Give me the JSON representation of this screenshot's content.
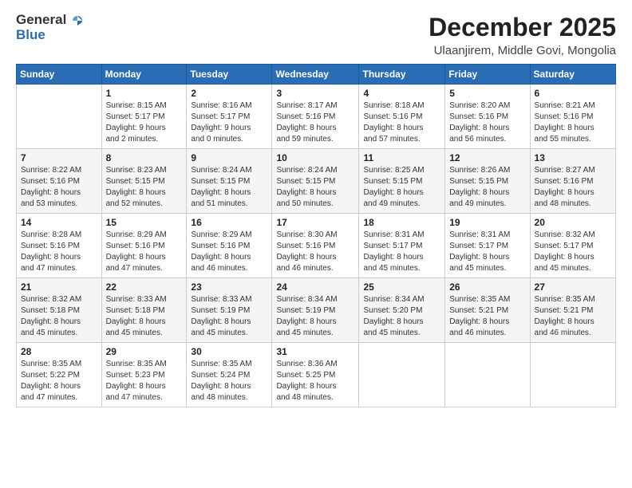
{
  "header": {
    "logo_general": "General",
    "logo_blue": "Blue",
    "main_title": "December 2025",
    "subtitle": "Ulaanjirem, Middle Govi, Mongolia"
  },
  "calendar": {
    "weekdays": [
      "Sunday",
      "Monday",
      "Tuesday",
      "Wednesday",
      "Thursday",
      "Friday",
      "Saturday"
    ],
    "weeks": [
      [
        {
          "day": "",
          "detail": ""
        },
        {
          "day": "1",
          "detail": "Sunrise: 8:15 AM\nSunset: 5:17 PM\nDaylight: 9 hours\nand 2 minutes."
        },
        {
          "day": "2",
          "detail": "Sunrise: 8:16 AM\nSunset: 5:17 PM\nDaylight: 9 hours\nand 0 minutes."
        },
        {
          "day": "3",
          "detail": "Sunrise: 8:17 AM\nSunset: 5:16 PM\nDaylight: 8 hours\nand 59 minutes."
        },
        {
          "day": "4",
          "detail": "Sunrise: 8:18 AM\nSunset: 5:16 PM\nDaylight: 8 hours\nand 57 minutes."
        },
        {
          "day": "5",
          "detail": "Sunrise: 8:20 AM\nSunset: 5:16 PM\nDaylight: 8 hours\nand 56 minutes."
        },
        {
          "day": "6",
          "detail": "Sunrise: 8:21 AM\nSunset: 5:16 PM\nDaylight: 8 hours\nand 55 minutes."
        }
      ],
      [
        {
          "day": "7",
          "detail": "Sunrise: 8:22 AM\nSunset: 5:16 PM\nDaylight: 8 hours\nand 53 minutes."
        },
        {
          "day": "8",
          "detail": "Sunrise: 8:23 AM\nSunset: 5:15 PM\nDaylight: 8 hours\nand 52 minutes."
        },
        {
          "day": "9",
          "detail": "Sunrise: 8:24 AM\nSunset: 5:15 PM\nDaylight: 8 hours\nand 51 minutes."
        },
        {
          "day": "10",
          "detail": "Sunrise: 8:24 AM\nSunset: 5:15 PM\nDaylight: 8 hours\nand 50 minutes."
        },
        {
          "day": "11",
          "detail": "Sunrise: 8:25 AM\nSunset: 5:15 PM\nDaylight: 8 hours\nand 49 minutes."
        },
        {
          "day": "12",
          "detail": "Sunrise: 8:26 AM\nSunset: 5:15 PM\nDaylight: 8 hours\nand 49 minutes."
        },
        {
          "day": "13",
          "detail": "Sunrise: 8:27 AM\nSunset: 5:16 PM\nDaylight: 8 hours\nand 48 minutes."
        }
      ],
      [
        {
          "day": "14",
          "detail": "Sunrise: 8:28 AM\nSunset: 5:16 PM\nDaylight: 8 hours\nand 47 minutes."
        },
        {
          "day": "15",
          "detail": "Sunrise: 8:29 AM\nSunset: 5:16 PM\nDaylight: 8 hours\nand 47 minutes."
        },
        {
          "day": "16",
          "detail": "Sunrise: 8:29 AM\nSunset: 5:16 PM\nDaylight: 8 hours\nand 46 minutes."
        },
        {
          "day": "17",
          "detail": "Sunrise: 8:30 AM\nSunset: 5:16 PM\nDaylight: 8 hours\nand 46 minutes."
        },
        {
          "day": "18",
          "detail": "Sunrise: 8:31 AM\nSunset: 5:17 PM\nDaylight: 8 hours\nand 45 minutes."
        },
        {
          "day": "19",
          "detail": "Sunrise: 8:31 AM\nSunset: 5:17 PM\nDaylight: 8 hours\nand 45 minutes."
        },
        {
          "day": "20",
          "detail": "Sunrise: 8:32 AM\nSunset: 5:17 PM\nDaylight: 8 hours\nand 45 minutes."
        }
      ],
      [
        {
          "day": "21",
          "detail": "Sunrise: 8:32 AM\nSunset: 5:18 PM\nDaylight: 8 hours\nand 45 minutes."
        },
        {
          "day": "22",
          "detail": "Sunrise: 8:33 AM\nSunset: 5:18 PM\nDaylight: 8 hours\nand 45 minutes."
        },
        {
          "day": "23",
          "detail": "Sunrise: 8:33 AM\nSunset: 5:19 PM\nDaylight: 8 hours\nand 45 minutes."
        },
        {
          "day": "24",
          "detail": "Sunrise: 8:34 AM\nSunset: 5:19 PM\nDaylight: 8 hours\nand 45 minutes."
        },
        {
          "day": "25",
          "detail": "Sunrise: 8:34 AM\nSunset: 5:20 PM\nDaylight: 8 hours\nand 45 minutes."
        },
        {
          "day": "26",
          "detail": "Sunrise: 8:35 AM\nSunset: 5:21 PM\nDaylight: 8 hours\nand 46 minutes."
        },
        {
          "day": "27",
          "detail": "Sunrise: 8:35 AM\nSunset: 5:21 PM\nDaylight: 8 hours\nand 46 minutes."
        }
      ],
      [
        {
          "day": "28",
          "detail": "Sunrise: 8:35 AM\nSunset: 5:22 PM\nDaylight: 8 hours\nand 47 minutes."
        },
        {
          "day": "29",
          "detail": "Sunrise: 8:35 AM\nSunset: 5:23 PM\nDaylight: 8 hours\nand 47 minutes."
        },
        {
          "day": "30",
          "detail": "Sunrise: 8:35 AM\nSunset: 5:24 PM\nDaylight: 8 hours\nand 48 minutes."
        },
        {
          "day": "31",
          "detail": "Sunrise: 8:36 AM\nSunset: 5:25 PM\nDaylight: 8 hours\nand 48 minutes."
        },
        {
          "day": "",
          "detail": ""
        },
        {
          "day": "",
          "detail": ""
        },
        {
          "day": "",
          "detail": ""
        }
      ]
    ]
  }
}
